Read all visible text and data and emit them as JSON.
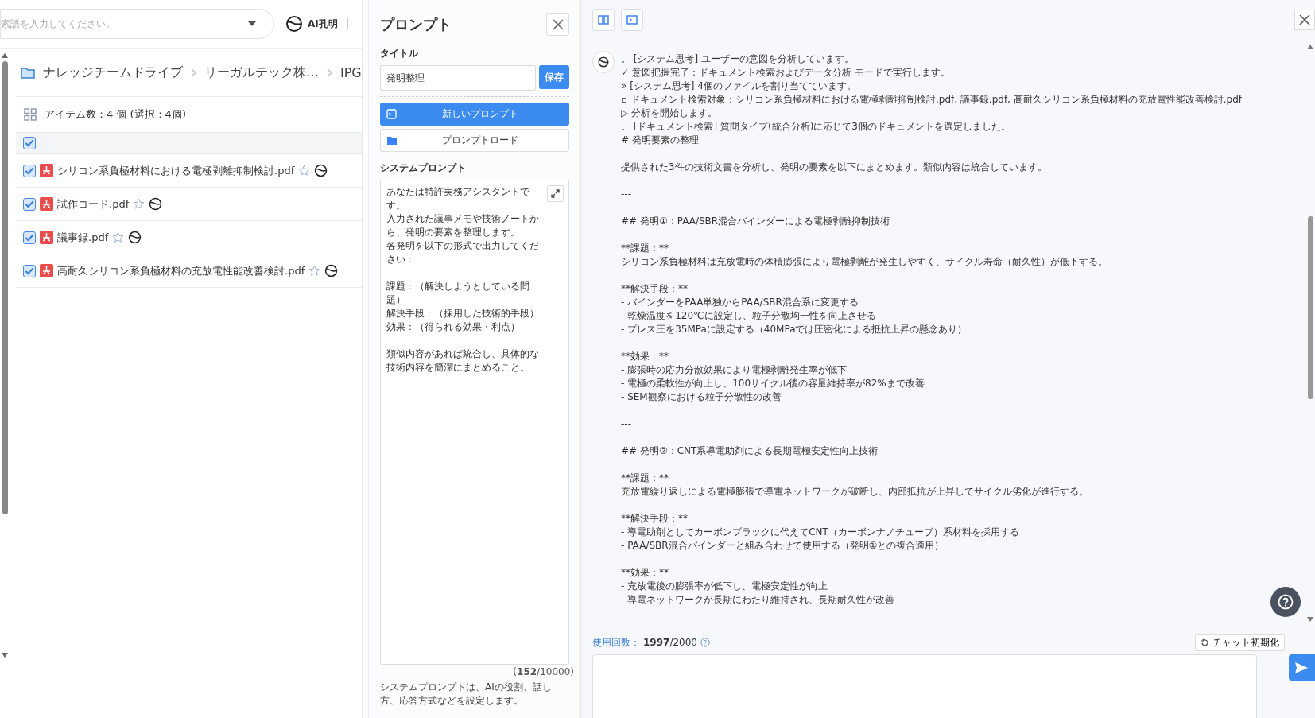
{
  "search": {
    "placeholder": "索語を入力してください。"
  },
  "brand": {
    "name": "AI孔明"
  },
  "breadcrumb": [
    "ナレッジチームドライブ",
    "リーガルテック株…",
    "IPG"
  ],
  "item_count": "アイテム数：4 個 (選択：4個)",
  "select_all": {
    "checked": true
  },
  "files": [
    {
      "name": "シリコン系負極材料における電極剥離抑制検討.pdf",
      "checked": true,
      "starred": false
    },
    {
      "name": "試作コード.pdf",
      "checked": true,
      "starred": false
    },
    {
      "name": "議事録.pdf",
      "checked": true,
      "starred": false
    },
    {
      "name": "高耐久シリコン系負極材料の充放電性能改善検討.pdf",
      "checked": true,
      "starred": false
    }
  ],
  "prompt_panel": {
    "heading": "プロンプト",
    "title_label": "タイトル",
    "title_value": "発明整理",
    "save": "保存",
    "new_prompt": "新しいプロンプト",
    "load_prompt": "プロンプトロード",
    "system_label": "システムプロンプト",
    "system_value": [
      [
        "あなたは特許実務アシスタントです。",
        "入力された議事メモや技術ノートから、発明の要素を整理します。",
        "各発明を以下の形式で出力してください："
      ],
      [
        "課題：（解決しようとしている問題）",
        "解決手段：（採用した技術的手段）",
        "効果：（得られる効果・利点）"
      ],
      [
        "類似内容があれば統合し、具体的な技術内容を簡潔にまとめること。"
      ]
    ],
    "counter": "(**152**/10000)",
    "help": "システムプロンプトは、AIの役割、話し方、応答方式などを設定します。"
  },
  "message": {
    "blocks": [
      [
        "。 [システム思考] ユーザーの意図を分析しています。",
        "✓ 意図把握完了：ドキュメント検索およびデータ分析 モードで実行します。",
        "» [システム思考] 4個のファイルを割り当てています。",
        "▫ ドキュメント検索対象：シリコン系負極材料における電極剥離抑制検討.pdf, 議事録.pdf, 高耐久シリコン系負極材料の充放電性能改善検討.pdf",
        "▷ 分析を開始します。",
        "。 [ドキュメント検索] 質問タイプ(統合分析)に応じて3個のドキュメントを選定しました。",
        "# 発明要素の整理"
      ],
      [
        "提供された3件の技術文書を分析し、発明の要素を以下にまとめます。類似内容は統合しています。"
      ],
      [
        "---"
      ],
      [
        "## 発明①：PAA/SBR混合バインダーによる電極剥離抑制技術"
      ],
      [
        "**課題：**",
        "シリコン系負極材料は充放電時の体積膨張により電極剥離が発生しやすく、サイクル寿命（耐久性）が低下する。"
      ],
      [
        "**解決手段：**",
        "- バインダーをPAA単独からPAA/SBR混合系に変更する",
        "- 乾燥温度を120℃に設定し、粒子分散均一性を向上させる",
        "- プレス圧を35MPaに設定する（40MPaでは圧密化による抵抗上昇の懸念あり）"
      ],
      [
        "**効果：**",
        "- 膨張時の応力分散効果により電極剥離発生率が低下",
        "- 電極の柔軟性が向上し、100サイクル後の容量維持率が82%まで改善",
        "- SEM観察における粒子分散性の改善"
      ],
      [
        "---"
      ],
      [
        "## 発明②：CNT系導電助剤による長期電極安定性向上技術"
      ],
      [
        "**課題：**",
        "充放電繰り返しによる電極膨張で導電ネットワークが破断し、内部抵抗が上昇してサイクル劣化が進行する。"
      ],
      [
        "**解決手段：**",
        "- 導電助剤としてカーボンブラックに代えてCNT（カーボンナノチューブ）系材料を採用する",
        "- PAA/SBR混合バインダーと組み合わせて使用する（発明①との複合適用）"
      ],
      [
        "**効果：**",
        "- 充放電後の膨張率が低下し、電極安定性が向上",
        "- 導電ネットワークが長期にわたり維持され、長期耐久性が改善"
      ]
    ]
  },
  "usage": {
    "label": "使用回数：",
    "value": "**1997**/2000"
  },
  "reset": "チャット初期化"
}
